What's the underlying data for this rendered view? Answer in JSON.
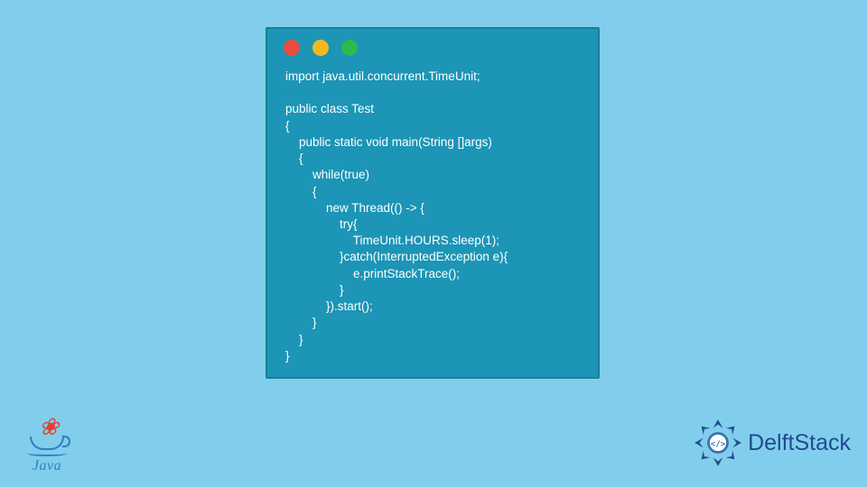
{
  "code_window": {
    "dots": [
      "red",
      "yellow",
      "green"
    ],
    "lines": [
      "import java.util.concurrent.TimeUnit;",
      "",
      "public class Test",
      "{",
      "    public static void main(String []args)",
      "    {",
      "        while(true)",
      "        {",
      "            new Thread(() -> {",
      "                try{",
      "                    TimeUnit.HOURS.sleep(1);",
      "                }catch(InterruptedException e){",
      "                    e.printStackTrace();",
      "                }",
      "            }).start();",
      "        }",
      "    }",
      "}"
    ]
  },
  "java_logo": {
    "text": "Java"
  },
  "delftstack": {
    "text": "DelftStack"
  }
}
